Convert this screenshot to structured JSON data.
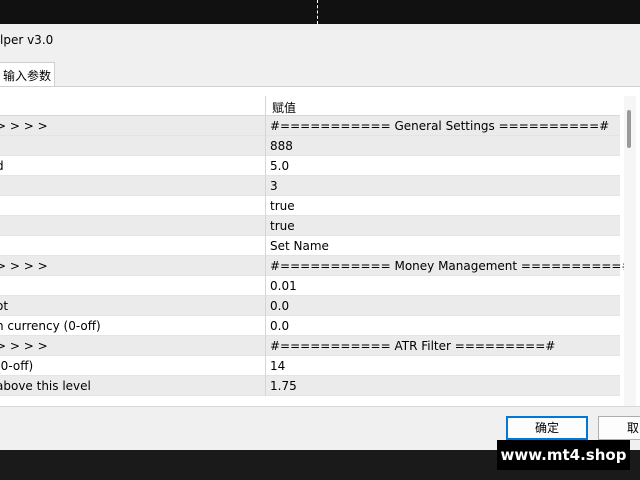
{
  "window": {
    "title": "lper v3.0"
  },
  "tab": {
    "label": "输入参数"
  },
  "table": {
    "value_header": "赋值",
    "rows": [
      {
        "name": "> > > >",
        "value": "#=========== General Settings ==========#"
      },
      {
        "name": "",
        "value": "888"
      },
      {
        "name": "d",
        "value": "5.0"
      },
      {
        "name": "",
        "value": "3"
      },
      {
        "name": "",
        "value": "true"
      },
      {
        "name": "",
        "value": "true"
      },
      {
        "name": "",
        "value": "Set Name"
      },
      {
        "name": "> > > >",
        "value": "#=========== Money Management ==========#"
      },
      {
        "name": "",
        "value": "0.01"
      },
      {
        "name": "ot",
        "value": "0.0"
      },
      {
        "name": "n currency (0-off)",
        "value": "0.0"
      },
      {
        "name": "> > > >",
        "value": "#=========== ATR Filter =========#"
      },
      {
        "name": " (0-off)",
        "value": "14"
      },
      {
        "name": " above this level",
        "value": "1.75"
      }
    ]
  },
  "buttons": {
    "ok": "确定",
    "cancel": "取"
  },
  "watermark": "www.mt4.shop"
}
